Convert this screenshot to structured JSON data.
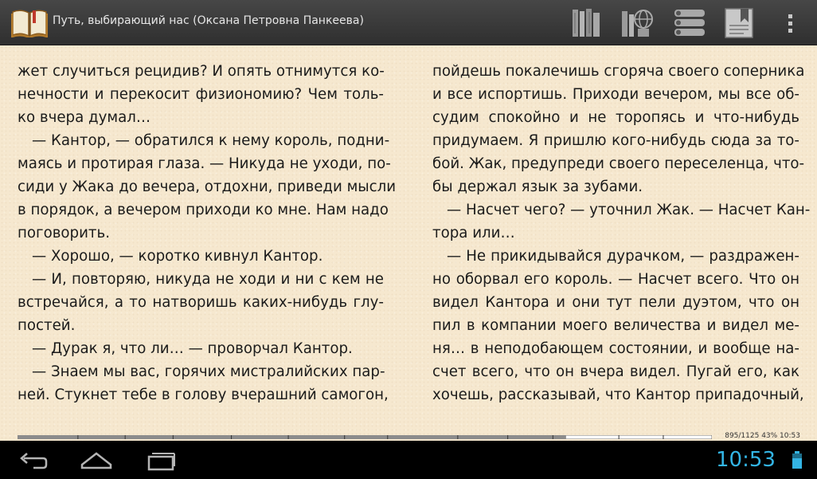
{
  "app": {
    "title": "Путь, выбирающий нас (Оксана Петровна Панкеева)"
  },
  "toolbar": {
    "icons": [
      "library-icon",
      "network-library-icon",
      "table-of-contents-icon",
      "bookmarks-icon",
      "menu-overflow-icon"
    ]
  },
  "book": {
    "left_column": [
      {
        "text": "жет случиться рецидив? И опять отнимутся ко-",
        "indent": false,
        "last": false
      },
      {
        "text": "нечности и перекосит физиономию? Чем толь-",
        "indent": false,
        "last": false
      },
      {
        "text": "ко вчера думал…",
        "indent": false,
        "last": true
      },
      {
        "text": "— Кантор, — обратился к нему король, подни-",
        "indent": true,
        "last": false
      },
      {
        "text": "маясь и протирая глаза. — Никуда не уходи, по-",
        "indent": false,
        "last": false
      },
      {
        "text": "сиди у Жака до вечера, отдохни, приведи мысли",
        "indent": false,
        "last": false
      },
      {
        "text": "в порядок, а вечером приходи ко мне. Нам надо",
        "indent": false,
        "last": false
      },
      {
        "text": "поговорить.",
        "indent": false,
        "last": true
      },
      {
        "text": "— Хорошо, — коротко кивнул Кантор.",
        "indent": true,
        "last": true
      },
      {
        "text": "— И, повторяю, никуда не ходи и ни с кем не",
        "indent": true,
        "last": false
      },
      {
        "text": "встречайся, а то натворишь каких-нибудь глу-",
        "indent": false,
        "last": false
      },
      {
        "text": "постей.",
        "indent": false,
        "last": true
      },
      {
        "text": "— Дурак я, что ли… — проворчал Кантор.",
        "indent": true,
        "last": true
      },
      {
        "text": "— Знаем мы вас, горячих мистралийских пар-",
        "indent": true,
        "last": false
      },
      {
        "text": "ней. Стукнет тебе в голову вчерашний самогон,",
        "indent": false,
        "last": false
      }
    ],
    "right_column": [
      {
        "text": "пойдешь покалечишь сгоряча своего соперника",
        "indent": false,
        "last": false
      },
      {
        "text": "и все испортишь. Приходи вечером, мы все об-",
        "indent": false,
        "last": false
      },
      {
        "text": "судим спокойно и не торопясь и что-нибудь",
        "indent": false,
        "last": false
      },
      {
        "text": "придумаем. Я пришлю кого-нибудь сюда за то-",
        "indent": false,
        "last": false
      },
      {
        "text": "бой. Жак, предупреди своего переселенца, что-",
        "indent": false,
        "last": false
      },
      {
        "text": "бы держал язык за зубами.",
        "indent": false,
        "last": true
      },
      {
        "text": "— Насчет чего? — уточнил Жак. — Насчет Кан-",
        "indent": true,
        "last": false
      },
      {
        "text": "тора или…",
        "indent": false,
        "last": true
      },
      {
        "text": "— Не прикидывайся дурачком, — раздражен-",
        "indent": true,
        "last": false
      },
      {
        "text": "но оборвал его король. — Насчет всего. Что он",
        "indent": false,
        "last": false
      },
      {
        "text": "видел Кантора и они тут пели дуэтом, что он",
        "indent": false,
        "last": false
      },
      {
        "text": "пил в компании моего величества и видел ме-",
        "indent": false,
        "last": false
      },
      {
        "text": "ня… в неподобающем состоянии, и вообще на-",
        "indent": false,
        "last": false
      },
      {
        "text": "счет всего, что он вчера видел. Пугай его, как",
        "indent": false,
        "last": false
      },
      {
        "text": "хочешь, рассказывай, что Кантор припадочный,",
        "indent": false,
        "last": false
      }
    ]
  },
  "progress": {
    "text": "895/1125 43% 10:53",
    "fraction": 0.79,
    "chapter_marks": [
      0.087,
      0.155,
      0.224,
      0.308,
      0.39,
      0.471,
      0.533,
      0.634,
      0.706,
      0.771,
      0.866,
      0.93
    ]
  },
  "status": {
    "time": "10:53",
    "clock_color": "#33b5e5"
  },
  "nav": {
    "icons": [
      "back-icon",
      "home-icon",
      "recent-apps-icon"
    ]
  }
}
